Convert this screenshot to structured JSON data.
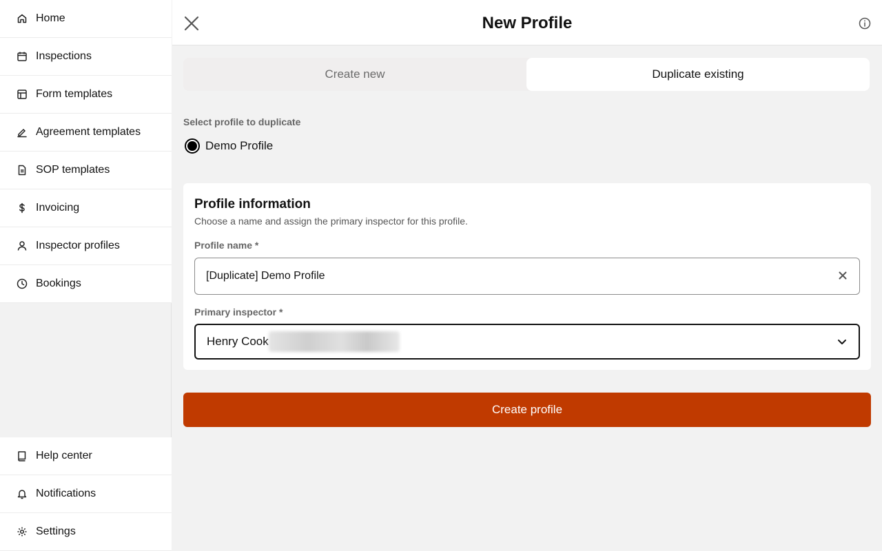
{
  "sidebar": {
    "top_items": [
      {
        "label": "Home",
        "icon": "home-icon"
      },
      {
        "label": "Inspections",
        "icon": "calendar-icon"
      },
      {
        "label": "Form templates",
        "icon": "layout-icon"
      },
      {
        "label": "Agreement templates",
        "icon": "signature-icon"
      },
      {
        "label": "SOP templates",
        "icon": "document-icon"
      },
      {
        "label": "Invoicing",
        "icon": "dollar-icon"
      },
      {
        "label": "Inspector profiles",
        "icon": "user-icon"
      },
      {
        "label": "Bookings",
        "icon": "clock-icon"
      }
    ],
    "bottom_items": [
      {
        "label": "Help center",
        "icon": "book-icon"
      },
      {
        "label": "Notifications",
        "icon": "bell-icon"
      },
      {
        "label": "Settings",
        "icon": "gear-icon"
      }
    ]
  },
  "header": {
    "title": "New Profile"
  },
  "tabs": {
    "create_new": "Create new",
    "duplicate_existing": "Duplicate existing",
    "active": "duplicate_existing"
  },
  "duplicate": {
    "label": "Select profile to duplicate",
    "option": "Demo Profile",
    "selected": true
  },
  "profile_info": {
    "title": "Profile information",
    "subtitle": "Choose a name and assign the primary inspector for this profile.",
    "name_label": "Profile name *",
    "name_value": "[Duplicate] Demo Profile",
    "inspector_label": "Primary inspector *",
    "inspector_value": "Henry Cook"
  },
  "actions": {
    "create_label": "Create profile"
  },
  "colors": {
    "accent": "#c03a00",
    "background": "#f2f2f2"
  }
}
